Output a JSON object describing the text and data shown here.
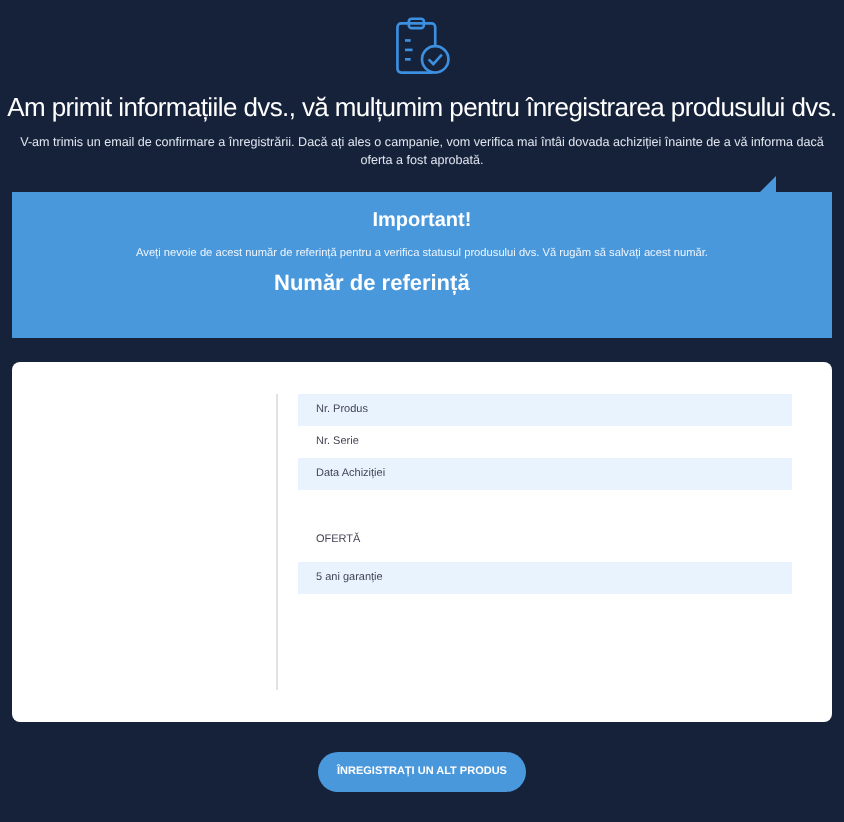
{
  "header": {
    "title": "Am primit informațiile dvs., vă mulțumim pentru înregistrarea produsului dvs.",
    "message": "V-am trimis un email de confirmare a înregistrării. Dacă ați ales o campanie, vom verifica mai întâi dovada achiziției înainte de a vă informa dacă oferta a fost aprobată."
  },
  "notice": {
    "title": "Important!",
    "text": "Aveți nevoie de acest număr de referință pentru a verifica statusul produsului dvs. Vă rugăm să salvați acest număr.",
    "reference_label": "Număr de referință"
  },
  "details": [
    {
      "label": "Nr. Produs",
      "shaded": true
    },
    {
      "label": "Nr. Serie",
      "shaded": false
    },
    {
      "label": "Data Achiziției",
      "shaded": true
    }
  ],
  "offer": {
    "heading": "OFERTĂ",
    "items": [
      {
        "label": "5 ani garanție",
        "shaded": true
      }
    ]
  },
  "button": "ÎNREGISTRAȚI UN ALT PRODUS"
}
